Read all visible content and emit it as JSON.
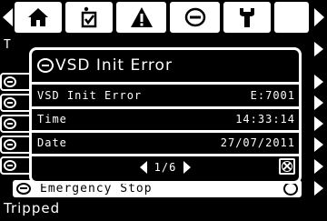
{
  "nav": {
    "tabs": [
      {
        "icon": "home-icon"
      },
      {
        "icon": "checklist-icon"
      },
      {
        "icon": "warning-icon"
      },
      {
        "icon": "stop-circle-icon",
        "active": true
      },
      {
        "icon": "wrench-icon"
      }
    ]
  },
  "background": {
    "partial_label": "T",
    "emergency_row_label": "Emergency Stop",
    "status_text": "Tripped"
  },
  "popup": {
    "title": "VSD Init Error",
    "fields": [
      {
        "label": "VSD Init Error",
        "value": "E:7001"
      },
      {
        "label": "Time",
        "value": "14:33:14"
      },
      {
        "label": "Date",
        "value": "27/07/2011"
      }
    ],
    "pager": "1/6"
  },
  "colors": {
    "background": "#000000",
    "foreground": "#ffffff"
  }
}
